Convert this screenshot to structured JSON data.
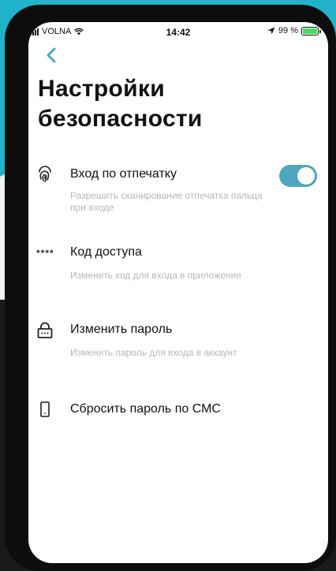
{
  "status_bar": {
    "carrier": "VOLNA",
    "time": "14:42",
    "battery": "99 %",
    "battery_level": 0.99
  },
  "page": {
    "title_line1": "Настройки",
    "title_line2": "безопасности"
  },
  "colors": {
    "accent": "#4ea7bd",
    "background_teal": "#21b3c9"
  },
  "settings": [
    {
      "icon": "fingerprint-icon",
      "title": "Вход по отпечатку",
      "description": "Разрешить сканирование отпечатка пальца при входе",
      "toggle_on": true
    },
    {
      "icon_text": "****",
      "title": "Код доступа",
      "description": "Изменить код для входа в приложение"
    },
    {
      "icon": "lock-icon",
      "title": "Изменить пароль",
      "description": "Изменить пароль для входа в аккаунт"
    },
    {
      "icon": "phone-icon",
      "title": "Сбросить пароль по СМС"
    }
  ]
}
